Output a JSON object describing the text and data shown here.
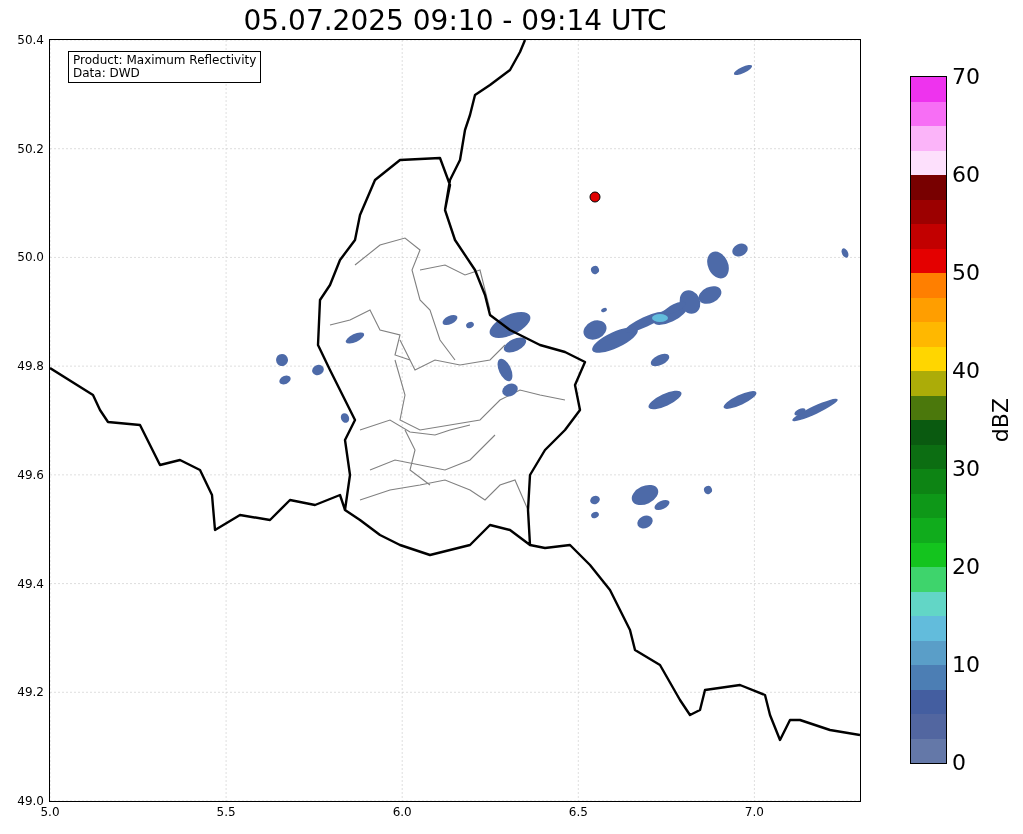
{
  "title": "05.07.2025 09:10 - 09:14 UTC",
  "legend": [
    "Product: Maximum Reflectivity",
    "Data: DWD"
  ],
  "map": {
    "x_ticks": [
      "5.0",
      "5.5",
      "6.0",
      "6.5",
      "7.0"
    ],
    "y_ticks": [
      "50.4",
      "50.2",
      "50.0",
      "49.8",
      "49.6",
      "49.4",
      "49.2",
      "49.0"
    ]
  },
  "colorbar": {
    "label": "dBZ",
    "ticks": [
      "70",
      "60",
      "50",
      "40",
      "30",
      "20",
      "10",
      "0"
    ],
    "bands": [
      {
        "color": "#ee33ee"
      },
      {
        "color": "#f76ef5"
      },
      {
        "color": "#fbb4f9"
      },
      {
        "color": "#fde0fc"
      },
      {
        "color": "#780000"
      },
      {
        "color": "#9c0000"
      },
      {
        "color": "#c20000"
      },
      {
        "color": "#e40000"
      },
      {
        "color": "#ff7f00"
      },
      {
        "color": "#ff9e00"
      },
      {
        "color": "#ffb800"
      },
      {
        "color": "#ffd600"
      },
      {
        "color": "#acac08"
      },
      {
        "color": "#4b780c"
      },
      {
        "color": "#0a5a10"
      },
      {
        "color": "#0c6e12"
      },
      {
        "color": "#0d8414"
      },
      {
        "color": "#0e9818"
      },
      {
        "color": "#10ac1c"
      },
      {
        "color": "#14c41e"
      },
      {
        "color": "#3ed46c"
      },
      {
        "color": "#62d6c6"
      },
      {
        "color": "#62bcdc"
      },
      {
        "color": "#5a9ec8"
      },
      {
        "color": "#4c7eb4"
      },
      {
        "color": "#445ea0"
      },
      {
        "color": "#5266a0"
      },
      {
        "color": "#6478a8"
      }
    ]
  }
}
